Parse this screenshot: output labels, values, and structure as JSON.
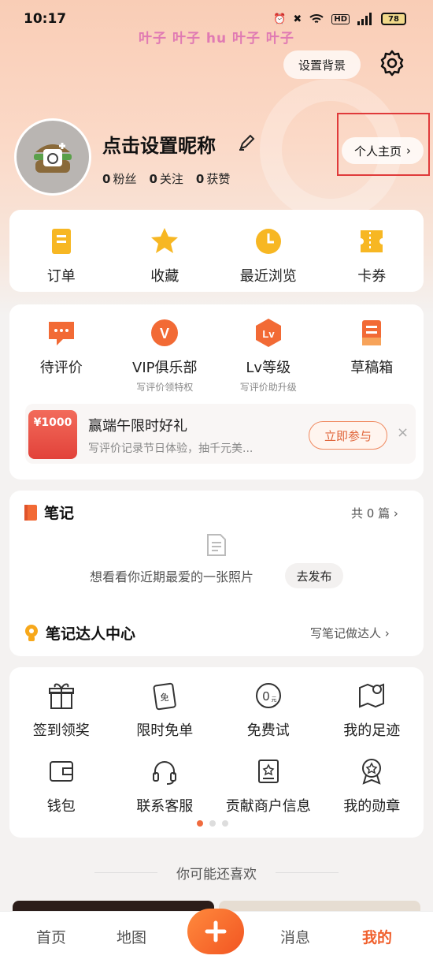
{
  "status_bar": {
    "time": "10:17",
    "battery": "78",
    "icons": [
      "alarm-icon",
      "mute-icon",
      "wifi-icon",
      "hd-icon",
      "signal-icon"
    ]
  },
  "watermark": "叶子 叶子 hu 叶子 叶子",
  "header": {
    "set_background_label": "设置背景",
    "settings_icon": "gear-icon"
  },
  "profile": {
    "nickname": "点击设置昵称",
    "fans_count": "0",
    "fans_label": "粉丝",
    "following_count": "0",
    "following_label": "关注",
    "likes_count": "0",
    "likes_label": "获赞",
    "homepage_label": "个人主页"
  },
  "quick_menu": [
    {
      "label": "订单",
      "icon": "order-icon"
    },
    {
      "label": "收藏",
      "icon": "star-icon"
    },
    {
      "label": "最近浏览",
      "icon": "clock-icon"
    },
    {
      "label": "卡券",
      "icon": "coupon-icon"
    }
  ],
  "review_menu": [
    {
      "label": "待评价",
      "sub": "",
      "icon": "comment-icon"
    },
    {
      "label": "VIP俱乐部",
      "sub": "写评价领特权",
      "icon": "vip-icon"
    },
    {
      "label": "Lv等级",
      "sub": "写评价助升级",
      "icon": "level-icon"
    },
    {
      "label": "草稿箱",
      "sub": "",
      "icon": "draft-icon"
    }
  ],
  "promo": {
    "badge": "¥1000",
    "title": "赢端午限时好礼",
    "subtitle": "写评价记录节日体验，抽千元美...",
    "button": "立即参与",
    "close": "×"
  },
  "notes": {
    "title": "笔记",
    "count_label": "共 0 篇",
    "empty_text": "想看看你近期最爱的一张照片",
    "post_button": "去发布",
    "expert_title": "笔记达人中心",
    "expert_link": "写笔记做达人"
  },
  "services": [
    {
      "label": "签到领奖",
      "icon": "gift-icon"
    },
    {
      "label": "限时免单",
      "icon": "free-ticket-icon"
    },
    {
      "label": "免费试",
      "icon": "zero-price-icon"
    },
    {
      "label": "我的足迹",
      "icon": "footprint-map-icon"
    },
    {
      "label": "钱包",
      "icon": "wallet-icon"
    },
    {
      "label": "联系客服",
      "icon": "headset-icon"
    },
    {
      "label": "贡献商户信息",
      "icon": "store-info-icon"
    },
    {
      "label": "我的勋章",
      "icon": "medal-icon"
    }
  ],
  "recommend_title": "你可能还喜欢",
  "tabbar": {
    "home": "首页",
    "map": "地图",
    "add": "+",
    "messages": "消息",
    "mine": "我的"
  },
  "colors": {
    "accent": "#f0612e",
    "highlight_frame": "#e03a3a"
  }
}
